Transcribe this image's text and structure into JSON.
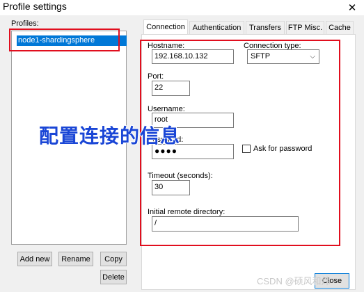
{
  "window": {
    "title": "Profile settings",
    "close_glyph": "✕"
  },
  "profiles": {
    "label": "Profiles:",
    "items": [
      "node1-shardingsphere"
    ]
  },
  "buttons": {
    "add_new": "Add new",
    "rename": "Rename",
    "copy": "Copy",
    "delete": "Delete",
    "close": "Close"
  },
  "tabs": [
    "Connection",
    "Authentication",
    "Transfers",
    "FTP Misc.",
    "Cache"
  ],
  "connection": {
    "hostname_label": "Hostname:",
    "hostname_value": "192.168.10.132",
    "type_label": "Connection type:",
    "type_value": "SFTP",
    "port_label": "Port:",
    "port_value": "22",
    "username_label": "Username:",
    "username_value": "root",
    "password_label": "Password:",
    "password_value": "●●●●",
    "ask_password_label": "Ask for password",
    "ask_password_checked": false,
    "timeout_label": "Timeout (seconds):",
    "timeout_value": "30",
    "initial_dir_label": "Initial remote directory:",
    "initial_dir_value": "/"
  },
  "annotation": "配置连接的信息",
  "watermark": "CSDN @硕风和炜",
  "colors": {
    "highlight": "#0078d7",
    "annotation_box": "#e10e1e",
    "annotation_text": "#1a46d6"
  },
  "icons": {
    "close": "close-icon",
    "dropdown": "chevron-down-icon"
  }
}
